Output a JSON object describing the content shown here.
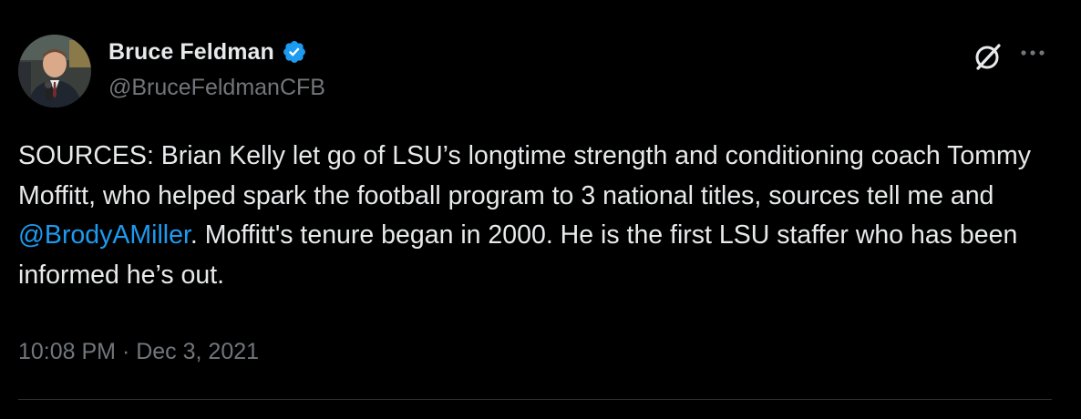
{
  "author": {
    "display_name": "Bruce Feldman",
    "handle": "@BruceFeldmanCFB",
    "verified": true
  },
  "tweet": {
    "text_before": "SOURCES: Brian Kelly let go of LSU’s longtime strength and conditioning coach Tommy Moffitt, who helped spark the football program to 3 national titles, sources tell me and ",
    "mention": "@BrodyAMiller",
    "text_after": ". Moffitt's tenure began in 2000. He is the first LSU staffer who has been informed he’s out.",
    "timestamp": "10:08 PM · Dec 3, 2021"
  },
  "actions": {
    "grok_icon": "grok-icon",
    "more_icon": "more-icon"
  },
  "colors": {
    "background": "#000000",
    "text": "#e7e9ea",
    "muted": "#71767b",
    "link": "#1d9bf0",
    "verified": "#1d9bf0",
    "divider": "#2f3336"
  }
}
